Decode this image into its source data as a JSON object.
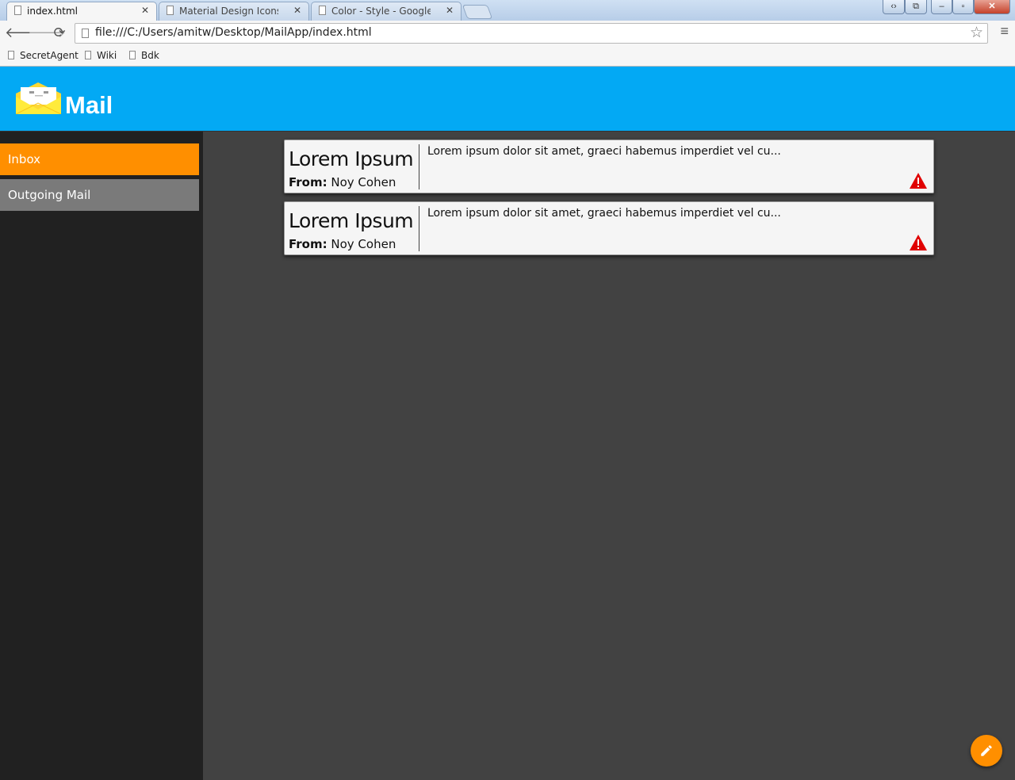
{
  "browser": {
    "tabs": [
      {
        "title": "index.html",
        "active": true
      },
      {
        "title": "Material Design Icons",
        "active": false
      },
      {
        "title": "Color - Style - Google desi",
        "active": false
      }
    ],
    "url": "file:///C:/Users/amitw/Desktop/MailApp/index.html",
    "bookmarks": [
      "SecretAgent",
      "Wiki",
      "Bdk"
    ]
  },
  "app": {
    "title": "Mail",
    "brand_color": "#03a9f4",
    "accent_color": "#ff8f00"
  },
  "sidebar": {
    "items": [
      {
        "label": "Inbox",
        "selected": true
      },
      {
        "label": "Outgoing Mail",
        "selected": false
      }
    ]
  },
  "mails": [
    {
      "subject": "Lorem Ipsum",
      "from_label": "From:",
      "from": " Noy Cohen",
      "preview": "Lorem ipsum dolor sit amet, graeci habemus imperdiet vel cu...",
      "flag_icon": "warning-icon"
    },
    {
      "subject": "Lorem Ipsum",
      "from_label": "From:",
      "from": " Noy Cohen",
      "preview": "Lorem ipsum dolor sit amet, graeci habemus imperdiet vel cu...",
      "flag_icon": "warning-icon"
    }
  ],
  "fab": {
    "icon": "pencil-icon"
  }
}
